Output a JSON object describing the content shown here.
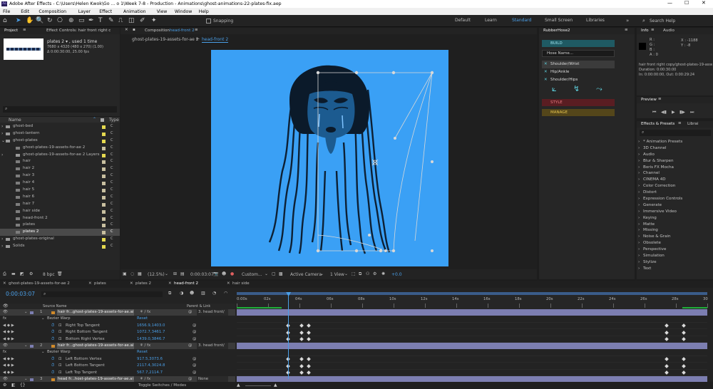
{
  "window": {
    "title": "Adobe After Effects - C:\\Users\\Helen Kwok\\Go ... o 1\\Week 7-8 - Production - Animations\\ghost-animations-22-plates-fix.aep"
  },
  "menu": [
    "File",
    "Edit",
    "Composition",
    "Layer",
    "Effect",
    "Animation",
    "View",
    "Window",
    "Help"
  ],
  "toolbar": {
    "snapping": "Snapping",
    "workspaces": [
      "Default",
      "Learn",
      "Standard",
      "Small Screen",
      "Libraries"
    ],
    "active_workspace": "Standard",
    "search_placeholder": "Search Help"
  },
  "project": {
    "tab": "Project",
    "tab2": "Effect Controls: hair front right c",
    "thumb_name": "plates 2 ▾ , used 1 time",
    "thumb_info1": "7680 x 4320  (480 x 270) (1.00)",
    "thumb_info2": "Δ 0:00:30:00, 25.00 fps",
    "col_name": "Name",
    "col_type": "Type",
    "items": [
      {
        "name": "ghost-bed",
        "indent": 0,
        "twirl": "›",
        "kind": "folder",
        "color": "#e5d94f",
        "sel": false
      },
      {
        "name": "ghost-lantern",
        "indent": 0,
        "twirl": "›",
        "kind": "folder",
        "color": "#e5d94f",
        "sel": false
      },
      {
        "name": "ghost-plates",
        "indent": 0,
        "twirl": "⌄",
        "kind": "folder",
        "color": "#e5d94f",
        "sel": false
      },
      {
        "name": "ghost-plates-19-assets-for-ae 2",
        "indent": 1,
        "twirl": "",
        "kind": "comp",
        "color": "#c8bfa0",
        "sel": false
      },
      {
        "name": "ghost-plates-19-assets-for-ae 2 Layers",
        "indent": 1,
        "twirl": "›",
        "kind": "folder",
        "color": "#e5d94f",
        "sel": false
      },
      {
        "name": "hair",
        "indent": 1,
        "twirl": "",
        "kind": "comp",
        "color": "#c8bfa0",
        "sel": false
      },
      {
        "name": "hair 2",
        "indent": 1,
        "twirl": "",
        "kind": "comp",
        "color": "#c8bfa0",
        "sel": false
      },
      {
        "name": "hair 3",
        "indent": 1,
        "twirl": "",
        "kind": "comp",
        "color": "#c8bfa0",
        "sel": false
      },
      {
        "name": "hair 4",
        "indent": 1,
        "twirl": "",
        "kind": "comp",
        "color": "#c8bfa0",
        "sel": false
      },
      {
        "name": "hair 5",
        "indent": 1,
        "twirl": "",
        "kind": "comp",
        "color": "#c8bfa0",
        "sel": false
      },
      {
        "name": "hair 6",
        "indent": 1,
        "twirl": "",
        "kind": "comp",
        "color": "#c8bfa0",
        "sel": false
      },
      {
        "name": "hair 7",
        "indent": 1,
        "twirl": "",
        "kind": "comp",
        "color": "#c8bfa0",
        "sel": false
      },
      {
        "name": "hair side",
        "indent": 1,
        "twirl": "",
        "kind": "comp",
        "color": "#c8bfa0",
        "sel": false
      },
      {
        "name": "head-front 2",
        "indent": 1,
        "twirl": "",
        "kind": "comp",
        "color": "#c8bfa0",
        "sel": false
      },
      {
        "name": "plates",
        "indent": 1,
        "twirl": "",
        "kind": "comp",
        "color": "#c8bfa0",
        "sel": false
      },
      {
        "name": "plates 2",
        "indent": 1,
        "twirl": "",
        "kind": "comp",
        "color": "#c8bfa0",
        "sel": true
      },
      {
        "name": "ghost-plates-original",
        "indent": 0,
        "twirl": "›",
        "kind": "folder",
        "color": "#e5d94f",
        "sel": false
      },
      {
        "name": "Solids",
        "indent": 0,
        "twirl": "›",
        "kind": "folder",
        "color": "#e5d94f",
        "sel": false
      }
    ],
    "bpc": "8 bpc"
  },
  "composition": {
    "tab_label": "Composition",
    "comp_name": "head-front 2",
    "crumb1": "ghost-plates-19-assets-for-ae 2",
    "crumb2": "head-front 2",
    "zoom": "(12.5%)",
    "time": "0:00:03:07",
    "view": "Custom...",
    "camera": "Active Camera",
    "views": "1 View",
    "exposure": "+0.0"
  },
  "rubberhose": {
    "title": "RubberHose2",
    "build": "BUILD",
    "hose_name_placeholder": "Hose Name...",
    "presets": [
      "Shoulder/Wrist",
      "Hip/Ankle",
      "Shoulder/Hips"
    ],
    "style": "STYLE",
    "manage": "MANAGE"
  },
  "info": {
    "tab": "Info",
    "tab2": "Audio",
    "r": "R :",
    "g": "G :",
    "b": "B :",
    "a": "A :  0",
    "x": "X : -1188",
    "y": "Y : -8",
    "line1": "hair front right copy/ghost-plates-19-assets",
    "line2": "Duration: 0:00:30:00",
    "line3": "In: 0:00:00:00, Out: 0:00:29:24"
  },
  "preview": {
    "tab": "Preview"
  },
  "effects": {
    "tab": "Effects & Presets",
    "tab2": "Librai",
    "items": [
      "* Animation Presets",
      "3D Channel",
      "Audio",
      "Blur & Sharpen",
      "Boris FX Mocha",
      "Channel",
      "CINEMA 4D",
      "Color Correction",
      "Distort",
      "Expression Controls",
      "Generate",
      "Immersive Video",
      "Keying",
      "Matte",
      "Missing",
      "Noise & Grain",
      "Obsolete",
      "Perspective",
      "Simulation",
      "Stylize",
      "Text"
    ]
  },
  "timeline": {
    "tabs": [
      "ghost-plates-19-assets-for-ae 2",
      "plates",
      "plates 2",
      "head-front 2",
      "hair side"
    ],
    "active_tab": "head-front 2",
    "timecode": "0:00:03:07",
    "col_source": "Source Name",
    "col_parent": "Parent & Link",
    "ruler": [
      "0:00s",
      "02s",
      "04s",
      "06s",
      "08s",
      "10s",
      "12s",
      "14s",
      "16s",
      "18s",
      "20s",
      "22s",
      "24s",
      "26s",
      "28s",
      "30"
    ],
    "playhead_seconds": 3.28,
    "duration_seconds": 30,
    "rows": [
      {
        "kind": "layer",
        "num": "1",
        "name": "hair fr...ghost-plates-19-assets-for-ae.ai",
        "parent": "3. head front/",
        "bar": "#7c7eb1"
      },
      {
        "kind": "effect",
        "name": "Bezier Warp",
        "value": "Reset"
      },
      {
        "kind": "prop",
        "name": "Right Top Tangent",
        "value": "1656.9,1403.0"
      },
      {
        "kind": "prop",
        "name": "Right Bottom Tangent",
        "value": "1072.7,3461.7"
      },
      {
        "kind": "prop",
        "name": "Bottom Right Vertex",
        "value": "1439.0,3846.7"
      },
      {
        "kind": "layer",
        "num": "2",
        "name": "hair fr...ghost-plates-19-assets-for-ae.ai",
        "parent": "3. head front/",
        "bar": "#7c7eb1"
      },
      {
        "kind": "effect",
        "name": "Bezier Warp",
        "value": "Reset"
      },
      {
        "kind": "prop",
        "name": "Left Bottom Vertex",
        "value": "917.5,3073.6"
      },
      {
        "kind": "prop",
        "name": "Left Bottom Tangent",
        "value": "2117.4,3024.8"
      },
      {
        "kind": "prop",
        "name": "Left Top Tangent",
        "value": "567.7,2114.7"
      },
      {
        "kind": "layer",
        "num": "3",
        "name": "head fr...host-plates-19-assets-for-ae.ai",
        "parent": "None",
        "bar": "#7c7eb1"
      }
    ],
    "keyframe_seconds": [
      3.28,
      4.15,
      4.6,
      27.4,
      28.5
    ],
    "toggle": "Toggle Switches / Modes"
  }
}
